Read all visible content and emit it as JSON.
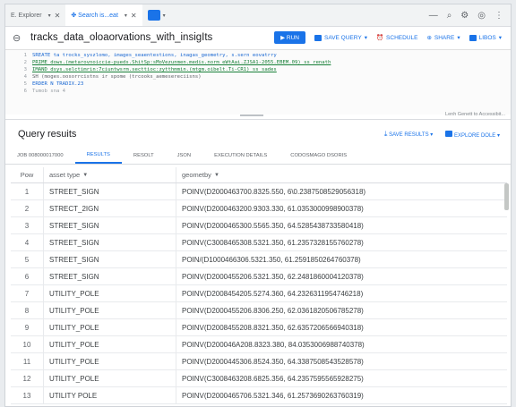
{
  "tabs": [
    {
      "label": "E. Explorer"
    },
    {
      "label": "✤ Search is...eat"
    }
  ],
  "query_title": "tracks_data_oloaorvations_with_insigIts",
  "toolbar": {
    "run": "RUN",
    "save_query": "SAVE QUERY",
    "schedule": "SCHEDULE",
    "share": "SHARE",
    "more": "LIBOS"
  },
  "editor": {
    "lines": [
      {
        "no": "1",
        "text": "SREATE ta trocks_syszlomo, images_seaentestions, inagas_geometry, s.sern eovatrry"
      },
      {
        "no": "2",
        "text": "PRIME dows.(metarovnoiccie-pueds.ShitSp:sMoVezunmen.medis.norm eWtAai.ZJSA1-2055.EBEM.09) ss renath"
      },
      {
        "no": "3",
        "text": "IMAND dsys.selctimrin:7ciuntwsrm.secttioc:zytthmmin.(mtgm.oibelt.Ti-CR1) ss sades"
      },
      {
        "no": "4",
        "text": "   SH (moges.oosorrcistns  ir  spome (trcooks_aemesereciisns)"
      },
      {
        "no": "5",
        "text": "ERDER N TRADIX.23"
      },
      {
        "no": "6",
        "text": "Tumob sna 4"
      }
    ],
    "hint": "Lenh Genett to Accessibit..."
  },
  "results": {
    "title": "Query resuits",
    "save_results": "SAVE RESULTS",
    "explore_data": "EXPLORE DOLE"
  },
  "result_tabs": [
    "JOB 008000017000",
    "RESULTS",
    "RESOLT",
    "JSON",
    "EXECUTION DETAILS",
    "CODOSMAGO DSORIS"
  ],
  "table": {
    "headers": [
      "Pow",
      "asset type",
      "geometby"
    ],
    "rows": [
      {
        "n": "1",
        "type": "STREET_SIGN",
        "geom": "POINV(D2000463700.8325.550, 6\\0.2387508529056318)"
      },
      {
        "n": "2",
        "type": "STRECT_2IGN",
        "geom": "POINV(D2000463200.9303.330, 61.0353000998900378)"
      },
      {
        "n": "3",
        "type": "STREET_SIGN",
        "geom": "POINV(D2000465300.5565.350, 64.5285438733580418)"
      },
      {
        "n": "4",
        "type": "STREET_SIGN",
        "geom": "POINV(C3008465308.5321.350, 61.2357328155760278)"
      },
      {
        "n": "5",
        "type": "STREET_SIGN",
        "geom": "POIN/(D1000466306.5321.350, 61.2591850264760378)"
      },
      {
        "n": "6",
        "type": "STREET_SIGN",
        "geom": "POINV(D2000455206.5321.350, 62.2481860004120378)"
      },
      {
        "n": "7",
        "type": "UTILITY_POLE",
        "geom": "POINV(D2008454205.5274.360, 64.2326311954746218)"
      },
      {
        "n": "8",
        "type": "UTILITY_POLE",
        "geom": "POINV(D2000455206.8306.250, 62.0361820506785278)"
      },
      {
        "n": "9",
        "type": "UTILITY_POLE",
        "geom": "POINV(D2008455208.8321.350, 62.6357206566940318)"
      },
      {
        "n": "10",
        "type": "UTILITY_POLE",
        "geom": "POINV(D200046A208.8323.380, 84.0353006988740378)"
      },
      {
        "n": "11",
        "type": "UTILITY_POLE",
        "geom": "POINV(D2000445306.8524.350, 64.3387508543528578)"
      },
      {
        "n": "12",
        "type": "UTILITY_POLE",
        "geom": "POINV(C3008463208.6825.356, 64.2357595565928275)"
      },
      {
        "n": "13",
        "type": "UTILITY POLE",
        "geom": "POINV(D2000465706.5321.346, 61.2573690263760319)"
      }
    ]
  },
  "colors": {
    "accent": "#1a73e8",
    "text": "#3c4043"
  }
}
